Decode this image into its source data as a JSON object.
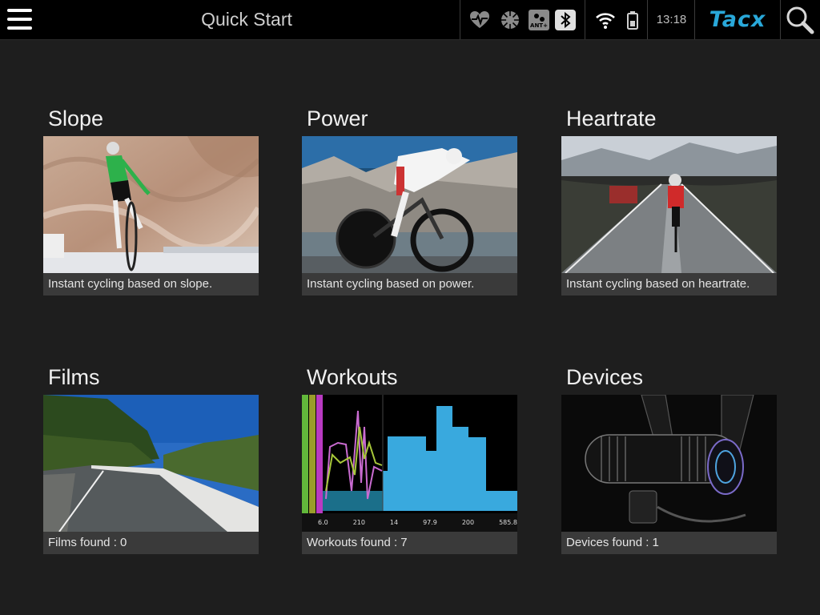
{
  "header": {
    "title": "Quick Start",
    "time": "13:18",
    "logo": "Tacx",
    "status_icons": [
      "heart-rate-sensor-icon",
      "cadence-sensor-icon",
      "ant-plus-icon",
      "bluetooth-icon",
      "wifi-icon",
      "battery-icon"
    ],
    "ant_label": "ANT+",
    "accent_color": "#29a8d9"
  },
  "tiles": [
    {
      "title": "Slope",
      "caption": "Instant cycling based on slope."
    },
    {
      "title": "Power",
      "caption": "Instant cycling based on power."
    },
    {
      "title": "Heartrate",
      "caption": "Instant cycling based on heartrate."
    },
    {
      "title": "Films",
      "caption": "Films found : 0"
    },
    {
      "title": "Workouts",
      "caption": "Workouts found : 7"
    },
    {
      "title": "Devices",
      "caption": "Devices found : 1"
    }
  ],
  "workout_thumb": {
    "stats": [
      "6.0",
      "210",
      "14",
      "97.9",
      "200",
      "585.8"
    ]
  }
}
